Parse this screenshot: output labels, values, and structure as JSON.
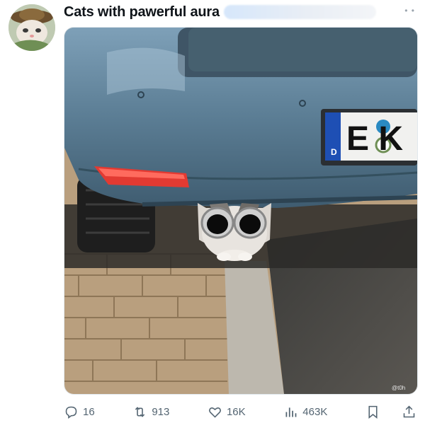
{
  "post": {
    "author_name": "Cats with pawerful aura",
    "media": {
      "plate_text": "E K",
      "plate_country": "D",
      "watermark": "@t0h"
    }
  },
  "actions": {
    "replies": "16",
    "reposts": "913",
    "likes": "16K",
    "views": "463K"
  },
  "icons": [
    "avatar-cat-icon",
    "verified-blur",
    "reply-icon",
    "repost-icon",
    "like-icon",
    "views-icon",
    "bookmark-icon",
    "share-icon"
  ],
  "colors": {
    "text": "#0f1419",
    "muted": "#536471",
    "car_body": "#5e7f95",
    "plate_blue": "#1e4fb4"
  }
}
